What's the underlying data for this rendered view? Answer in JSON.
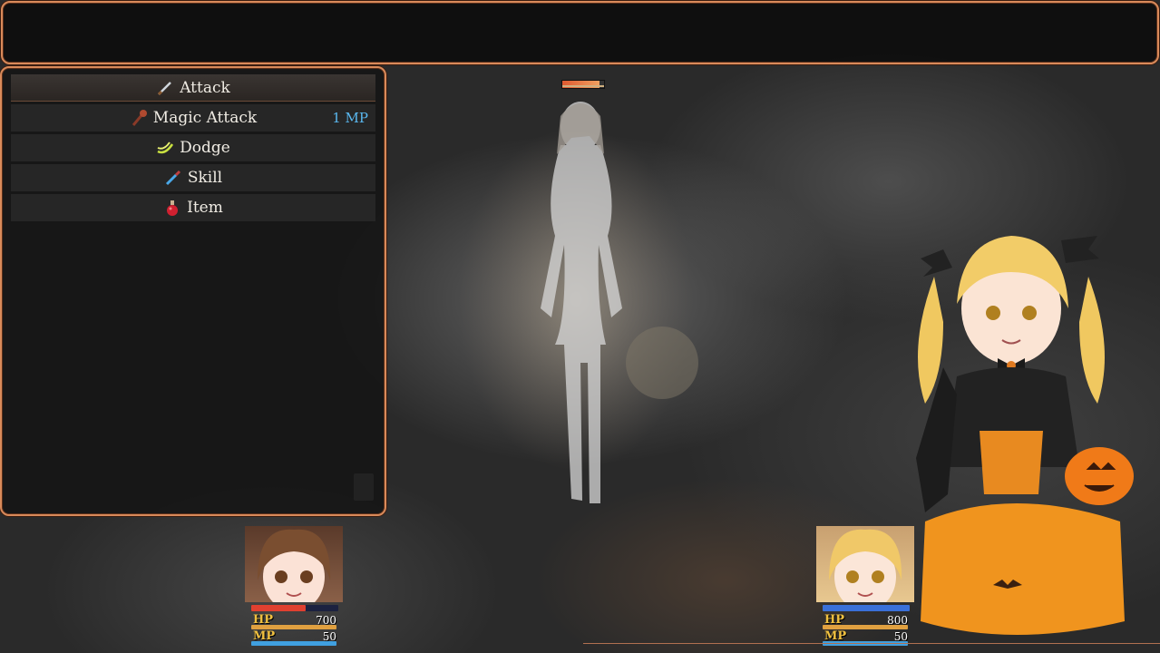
{
  "help": {
    "text": ""
  },
  "commands": [
    {
      "label": "Attack",
      "icon": "sword-icon",
      "selected": true
    },
    {
      "label": "Magic Attack",
      "icon": "staff-icon",
      "cost": "1 MP"
    },
    {
      "label": "Dodge",
      "icon": "wind-icon"
    },
    {
      "label": "Skill",
      "icon": "potion-dropper-icon"
    },
    {
      "label": "Item",
      "icon": "red-potion-icon"
    }
  ],
  "enemy": {
    "name": "",
    "hp_fraction": 0.9
  },
  "party": [
    {
      "hp_label": "HP",
      "hp": "700",
      "hp_fraction": 0.95,
      "top_bar_fraction": 0.62,
      "top_bar_color": "#e04030",
      "mp_label": "MP",
      "mp": "50",
      "mp_fraction": 1.0
    },
    {
      "hp_label": "HP",
      "hp": "800",
      "hp_fraction": 1.0,
      "top_bar_fraction": 1.0,
      "top_bar_color": "#3a70d8",
      "mp_label": "MP",
      "mp": "50",
      "mp_fraction": 1.0
    }
  ],
  "colors": {
    "accent": "#d98a5a",
    "mp_cost": "#5ab8f0",
    "hp_gauge": "#e0a040",
    "mp_gauge": "#40a0e0"
  }
}
